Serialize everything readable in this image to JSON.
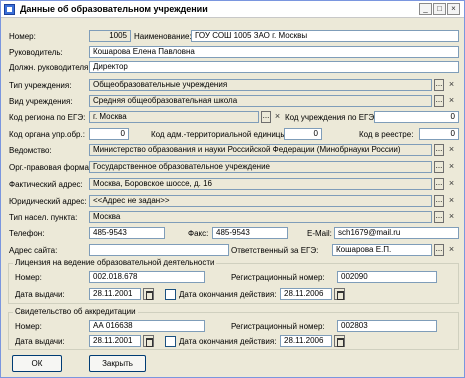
{
  "window": {
    "title": "Данные об образовательном учреждении",
    "controls": [
      "_",
      "□",
      "×"
    ]
  },
  "fields": {
    "nomer": {
      "label": "Номер:",
      "value": "1005"
    },
    "naimenovanie": {
      "label": "Наименование:",
      "value": "ГОУ СОШ 1005 ЗАО г. Москвы"
    },
    "rukovoditel": {
      "label": "Руководитель:",
      "value": "Кошарова Елена Павловна"
    },
    "dolzhn": {
      "label": "Должн. руководителя:",
      "value": "Директор"
    },
    "tip": {
      "label": "Тип учреждения:",
      "value": "Общеобразовательные учреждения"
    },
    "vid": {
      "label": "Вид учреждения:",
      "value": "Средняя общеобразовательная школа"
    },
    "kod_regiona": {
      "label": "Код региона по ЕГЭ:",
      "value": "г. Москва"
    },
    "kod_uchrezhdeniya": {
      "label": "Код учреждения по ЕГЭ:",
      "value": "0"
    },
    "kod_organa": {
      "label": "Код органа упр.обр.:",
      "value": "0"
    },
    "kod_adm": {
      "label": "Код адм.-территориальной единицы:",
      "value": "0"
    },
    "kod_reestr": {
      "label": "Код в реестре:",
      "value": "0"
    },
    "vedomstvo": {
      "label": "Ведомство:",
      "value": "Министерство образования и науки Российской Федерации (Минобрнауки России)"
    },
    "org_forma": {
      "label": "Орг.-правовая форма:",
      "value": "Государственное образовательное учреждение"
    },
    "fakt_adres": {
      "label": "Фактический адрес:",
      "value": "Москва, Боровское шоссе, д. 16"
    },
    "yur_adres": {
      "label": "Юридический адрес:",
      "value": "<<Адрес не задан>>"
    },
    "tip_nasel": {
      "label": "Тип насел. пункта:",
      "value": "Москва"
    },
    "telefon": {
      "label": "Телефон:",
      "value": "485-9543"
    },
    "faks": {
      "label": "Факс:",
      "value": "485-9543"
    },
    "email": {
      "label": "E-Mail:",
      "value": "sch1679@mail.ru"
    },
    "adres_saita": {
      "label": "Адрес сайта:",
      "value": ""
    },
    "otvetstvenny": {
      "label": "Ответственный за ЕГЭ:",
      "value": "Кошарова Е.П."
    }
  },
  "license": {
    "title": "Лицензия на ведение образовательной деятельности",
    "nomer_label": "Номер:",
    "nomer": "002.018.678",
    "reg_label": "Регистрационный номер:",
    "reg": "002090",
    "data_label": "Дата выдачи:",
    "data": "28.11.2001",
    "end_label": "Дата окончания действия:",
    "end": "28.11.2006"
  },
  "accreditation": {
    "title": "Свидетельство об аккредитации",
    "nomer_label": "Номер:",
    "nomer": "АА 016638",
    "reg_label": "Регистрационный номер:",
    "reg": "002803",
    "data_label": "Дата выдачи:",
    "data": "28.11.2001",
    "end_label": "Дата окончания действия:",
    "end": "28.11.2006"
  },
  "buttons": {
    "ok": "ОК",
    "close": "Закрыть"
  },
  "glyphs": {
    "dots": "...",
    "clear": "×"
  }
}
